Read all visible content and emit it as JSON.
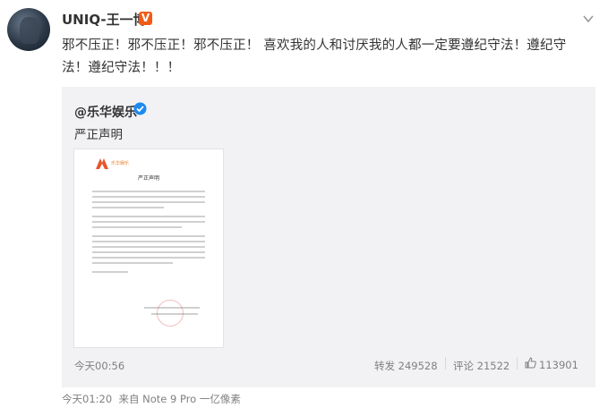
{
  "user": {
    "name": "UNIQ-王一博",
    "badge": "V"
  },
  "post": {
    "text": "邪不压正！邪不压正！邪不压正！ 喜欢我的人和讨厌我的人都一定要遵纪守法！遵纪守法！遵纪守法！！！",
    "time": "今天01:20",
    "source": "来自 Note 9 Pro 一亿像素"
  },
  "repost": {
    "user": "@乐华娱乐",
    "text": "严正声明",
    "time": "今天00:56",
    "forward": "转发 249528",
    "comment": "评论 21522",
    "likes": "113901",
    "doc_brand": "乐华娱乐",
    "doc_title": "严正声明"
  },
  "colors": {
    "brand_orange": "#f25a16",
    "verified_blue": "#1e8af0",
    "meta_grey": "#808080"
  },
  "icons": [
    "more-icon",
    "vip-badge",
    "verified-icon",
    "like-icon"
  ]
}
